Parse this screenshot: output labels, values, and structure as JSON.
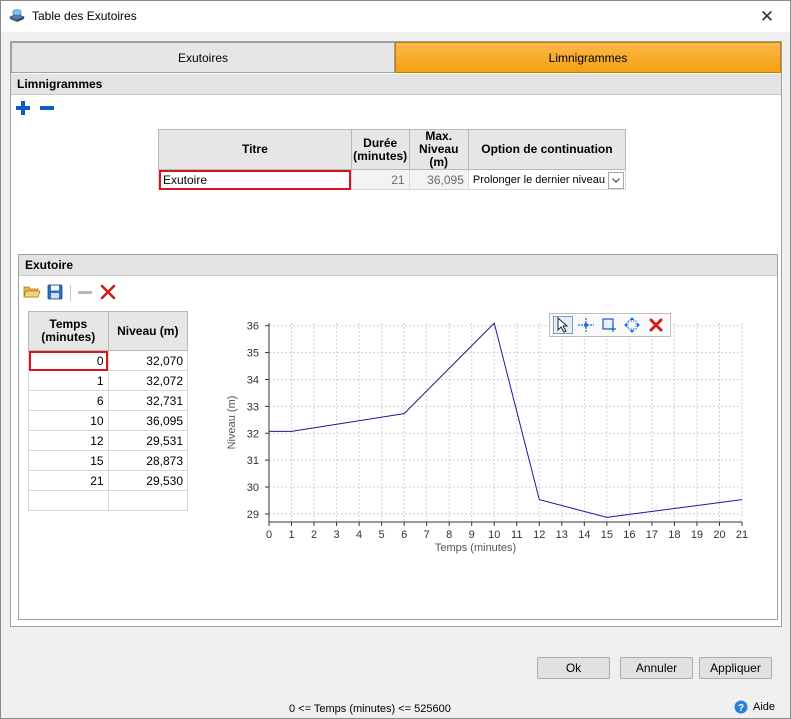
{
  "window": {
    "title": "Table des Exutoires",
    "close_symbol": "✕"
  },
  "tabs": [
    {
      "label": "Exutoires",
      "active": false
    },
    {
      "label": "Limnigrammes",
      "active": true
    }
  ],
  "limnigrammes": {
    "header": "Limnigrammes",
    "table": {
      "headers": {
        "titre": "Titre",
        "duree": "Durée\n(minutes)",
        "max": "Max.\nNiveau\n(m)",
        "option": "Option de continuation"
      },
      "rows": [
        {
          "titre": "Exutoire",
          "duree": "21",
          "max": "36,095",
          "option": "Prolonger le dernier niveau"
        }
      ]
    }
  },
  "exutoire": {
    "header": "Exutoire",
    "table": {
      "headers": {
        "temps": "Temps\n(minutes)",
        "niveau": "Niveau (m)"
      },
      "rows": [
        {
          "temps": "0",
          "niveau": "32,070"
        },
        {
          "temps": "1",
          "niveau": "32,072"
        },
        {
          "temps": "6",
          "niveau": "32,731"
        },
        {
          "temps": "10",
          "niveau": "36,095"
        },
        {
          "temps": "12",
          "niveau": "29,531"
        },
        {
          "temps": "15",
          "niveau": "28,873"
        },
        {
          "temps": "21",
          "niveau": "29,530"
        }
      ]
    }
  },
  "chart_data": {
    "type": "line",
    "x": [
      0,
      1,
      6,
      10,
      12,
      15,
      21
    ],
    "series": [
      {
        "values": [
          32.07,
          32.072,
          32.731,
          36.095,
          29.531,
          28.873,
          29.53
        ],
        "color": "#1a1a9a"
      }
    ],
    "xlabel": "Temps (minutes)",
    "ylabel": "Niveau (m)",
    "xlim": [
      0,
      21
    ],
    "ylim": [
      28.7,
      36.1
    ],
    "xticks": [
      0,
      1,
      2,
      3,
      4,
      5,
      6,
      7,
      8,
      9,
      10,
      11,
      12,
      13,
      14,
      15,
      16,
      17,
      18,
      19,
      20,
      21
    ],
    "yticks": [
      29,
      30,
      31,
      32,
      33,
      34,
      35,
      36
    ],
    "grid": true,
    "legend": false
  },
  "buttons": {
    "ok": "Ok",
    "cancel": "Annuler",
    "apply": "Appliquer"
  },
  "status_text": "0 <= Temps (minutes) <= 525600",
  "help_label": "Aide",
  "colors": {
    "active_tab": "#f5a011",
    "selection": "#d8141e",
    "accent_blue": "#0a5fbf",
    "delete_red": "#d01e1e"
  },
  "icons": {
    "add": "plus-icon",
    "remove": "minus-icon",
    "open": "folder-open-icon",
    "save": "save-icon",
    "delete_row": "minus-icon",
    "clear": "red-x-icon",
    "select": "cursor-icon",
    "crosshair": "crosshair-icon",
    "zoom": "zoom-box-icon",
    "pan": "pan-icon",
    "reset": "red-x-icon",
    "help": "help-icon"
  }
}
